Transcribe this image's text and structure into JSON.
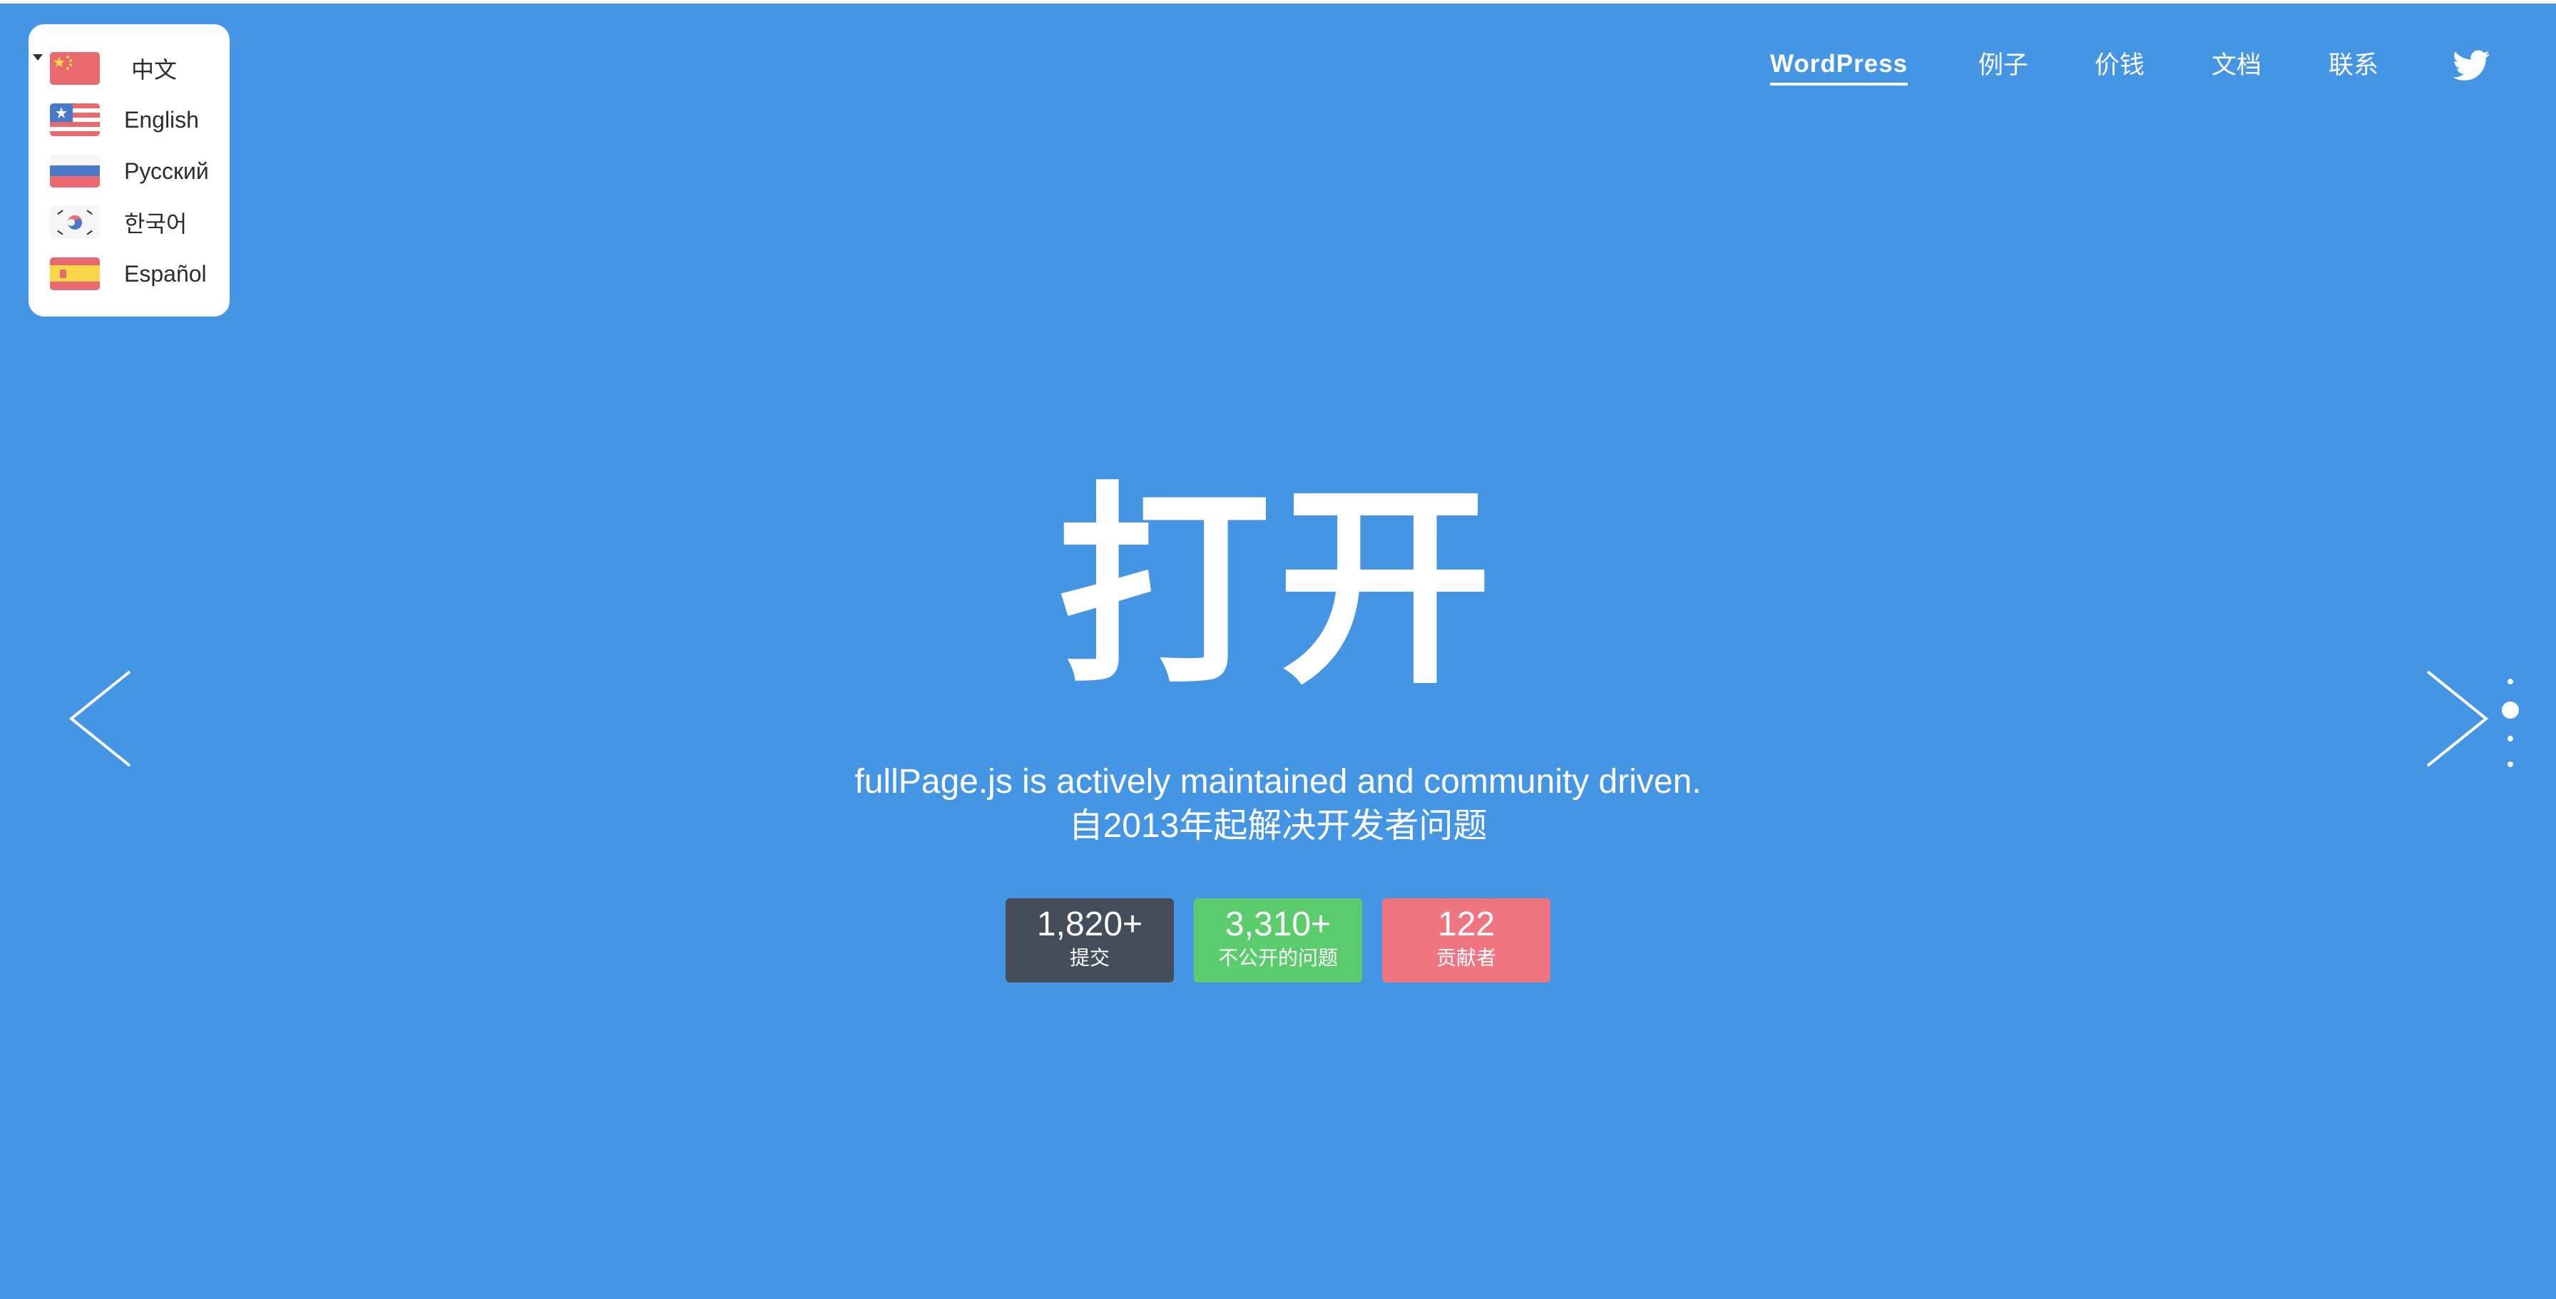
{
  "languages": [
    {
      "label": "中文",
      "icon": "china-flag-icon"
    },
    {
      "label": "English",
      "icon": "usa-flag-icon"
    },
    {
      "label": "Русский",
      "icon": "russia-flag-icon"
    },
    {
      "label": "한국어",
      "icon": "korea-flag-icon"
    },
    {
      "label": "Español",
      "icon": "spain-flag-icon"
    }
  ],
  "nav": {
    "items": [
      "WordPress",
      "例子",
      "价钱",
      "文档",
      "联系"
    ],
    "active": "WordPress",
    "social_icon": "twitter-icon"
  },
  "hero": {
    "title": "打开",
    "subtitle_line1": "fullPage.js is actively maintained and community driven.",
    "subtitle_line2": "自2013年起解决开发者问题"
  },
  "stats": [
    {
      "value": "1,820+",
      "label": "提交",
      "color": "#454c5a"
    },
    {
      "value": "3,310+",
      "label": "不公开的问题",
      "color": "#5acc6b"
    },
    {
      "value": "122",
      "label": "贡献者",
      "color": "#ef7681"
    }
  ],
  "colors": {
    "background": "#4496e5",
    "text": "#ffffff"
  },
  "slider": {
    "prev_icon": "chevron-left-icon",
    "next_icon": "chevron-right-icon",
    "dot_count": 4,
    "active_dot": 2
  }
}
